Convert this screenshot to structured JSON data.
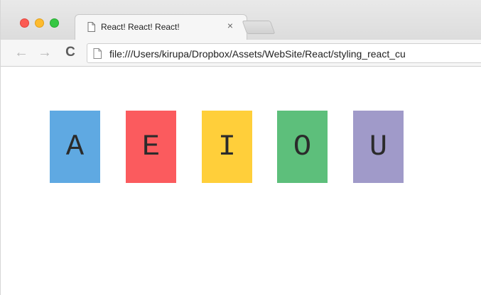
{
  "browser": {
    "tab": {
      "title": "React! React! React!",
      "close_glyph": "×"
    },
    "toolbar": {
      "back_glyph": "←",
      "forward_glyph": "→",
      "reload_glyph": "C",
      "address": "file:///Users/kirupa/Dropbox/Assets/WebSite/React/styling_react_cu"
    },
    "icons": [
      "page-icon",
      "back-arrow-icon",
      "forward-arrow-icon",
      "reload-icon",
      "close-icon"
    ]
  },
  "vowels": [
    {
      "letter": "A",
      "color": "#5fa9e2"
    },
    {
      "letter": "E",
      "color": "#fb5b5e"
    },
    {
      "letter": "I",
      "color": "#ffcf3a"
    },
    {
      "letter": "O",
      "color": "#5dbf7b"
    },
    {
      "letter": "U",
      "color": "#a09ac9"
    }
  ]
}
